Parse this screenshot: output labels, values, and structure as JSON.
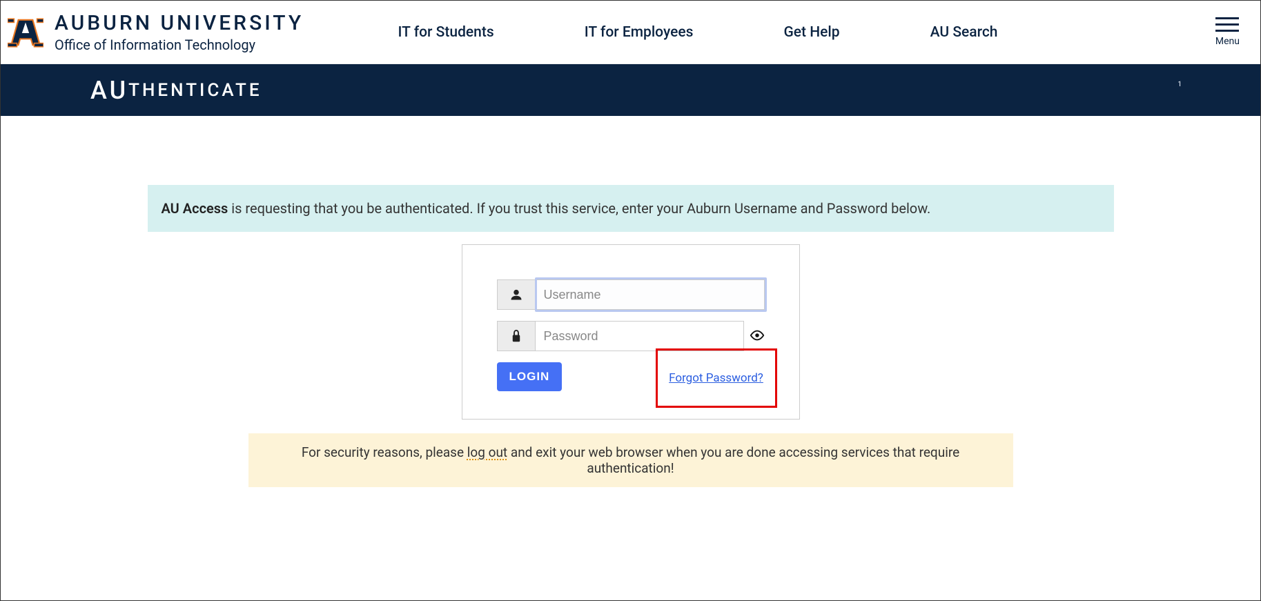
{
  "header": {
    "univ_title": "AUBURN UNIVERSITY",
    "subtitle": "Office of Information Technology",
    "nav": [
      "IT for Students",
      "IT for Employees",
      "Get Help",
      "AU Search"
    ],
    "menu_label": "Menu"
  },
  "banner": {
    "prefix": "AU",
    "rest": "THENTICATE",
    "tiny": "1"
  },
  "info": {
    "strong": "AU Access",
    "text": " is requesting that you be authenticated. If you trust this service, enter your Auburn Username and Password below."
  },
  "login": {
    "username_placeholder": "Username",
    "username_value": "",
    "password_placeholder": "Password",
    "password_value": "",
    "login_label": "LOGIN",
    "forgot_label": "Forgot Password?"
  },
  "warn": {
    "pre": "For security reasons, please ",
    "logout": "log out",
    "post": " and exit your web browser when you are done accessing services that require authentication!"
  }
}
